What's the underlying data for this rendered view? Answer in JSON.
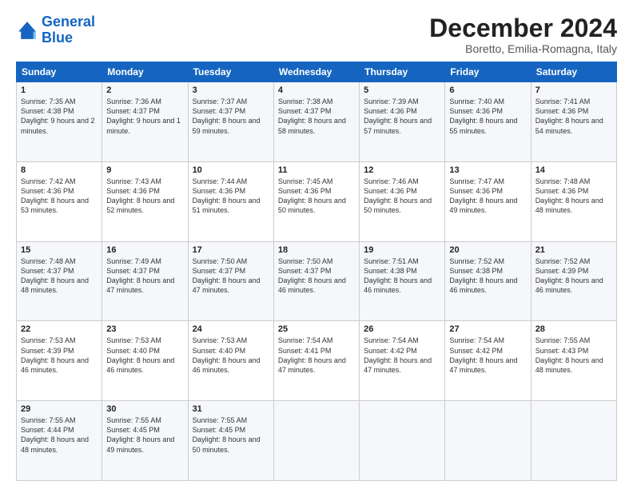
{
  "logo": {
    "line1": "General",
    "line2": "Blue"
  },
  "title": "December 2024",
  "location": "Boretto, Emilia-Romagna, Italy",
  "days_of_week": [
    "Sunday",
    "Monday",
    "Tuesday",
    "Wednesday",
    "Thursday",
    "Friday",
    "Saturday"
  ],
  "weeks": [
    [
      {
        "day": 1,
        "sunrise": "7:35 AM",
        "sunset": "4:38 PM",
        "daylight": "9 hours and 2 minutes."
      },
      {
        "day": 2,
        "sunrise": "7:36 AM",
        "sunset": "4:37 PM",
        "daylight": "9 hours and 1 minute."
      },
      {
        "day": 3,
        "sunrise": "7:37 AM",
        "sunset": "4:37 PM",
        "daylight": "8 hours and 59 minutes."
      },
      {
        "day": 4,
        "sunrise": "7:38 AM",
        "sunset": "4:37 PM",
        "daylight": "8 hours and 58 minutes."
      },
      {
        "day": 5,
        "sunrise": "7:39 AM",
        "sunset": "4:36 PM",
        "daylight": "8 hours and 57 minutes."
      },
      {
        "day": 6,
        "sunrise": "7:40 AM",
        "sunset": "4:36 PM",
        "daylight": "8 hours and 55 minutes."
      },
      {
        "day": 7,
        "sunrise": "7:41 AM",
        "sunset": "4:36 PM",
        "daylight": "8 hours and 54 minutes."
      }
    ],
    [
      {
        "day": 8,
        "sunrise": "7:42 AM",
        "sunset": "4:36 PM",
        "daylight": "8 hours and 53 minutes."
      },
      {
        "day": 9,
        "sunrise": "7:43 AM",
        "sunset": "4:36 PM",
        "daylight": "8 hours and 52 minutes."
      },
      {
        "day": 10,
        "sunrise": "7:44 AM",
        "sunset": "4:36 PM",
        "daylight": "8 hours and 51 minutes."
      },
      {
        "day": 11,
        "sunrise": "7:45 AM",
        "sunset": "4:36 PM",
        "daylight": "8 hours and 50 minutes."
      },
      {
        "day": 12,
        "sunrise": "7:46 AM",
        "sunset": "4:36 PM",
        "daylight": "8 hours and 50 minutes."
      },
      {
        "day": 13,
        "sunrise": "7:47 AM",
        "sunset": "4:36 PM",
        "daylight": "8 hours and 49 minutes."
      },
      {
        "day": 14,
        "sunrise": "7:48 AM",
        "sunset": "4:36 PM",
        "daylight": "8 hours and 48 minutes."
      }
    ],
    [
      {
        "day": 15,
        "sunrise": "7:48 AM",
        "sunset": "4:37 PM",
        "daylight": "8 hours and 48 minutes."
      },
      {
        "day": 16,
        "sunrise": "7:49 AM",
        "sunset": "4:37 PM",
        "daylight": "8 hours and 47 minutes."
      },
      {
        "day": 17,
        "sunrise": "7:50 AM",
        "sunset": "4:37 PM",
        "daylight": "8 hours and 47 minutes."
      },
      {
        "day": 18,
        "sunrise": "7:50 AM",
        "sunset": "4:37 PM",
        "daylight": "8 hours and 46 minutes."
      },
      {
        "day": 19,
        "sunrise": "7:51 AM",
        "sunset": "4:38 PM",
        "daylight": "8 hours and 46 minutes."
      },
      {
        "day": 20,
        "sunrise": "7:52 AM",
        "sunset": "4:38 PM",
        "daylight": "8 hours and 46 minutes."
      },
      {
        "day": 21,
        "sunrise": "7:52 AM",
        "sunset": "4:39 PM",
        "daylight": "8 hours and 46 minutes."
      }
    ],
    [
      {
        "day": 22,
        "sunrise": "7:53 AM",
        "sunset": "4:39 PM",
        "daylight": "8 hours and 46 minutes."
      },
      {
        "day": 23,
        "sunrise": "7:53 AM",
        "sunset": "4:40 PM",
        "daylight": "8 hours and 46 minutes."
      },
      {
        "day": 24,
        "sunrise": "7:53 AM",
        "sunset": "4:40 PM",
        "daylight": "8 hours and 46 minutes."
      },
      {
        "day": 25,
        "sunrise": "7:54 AM",
        "sunset": "4:41 PM",
        "daylight": "8 hours and 47 minutes."
      },
      {
        "day": 26,
        "sunrise": "7:54 AM",
        "sunset": "4:42 PM",
        "daylight": "8 hours and 47 minutes."
      },
      {
        "day": 27,
        "sunrise": "7:54 AM",
        "sunset": "4:42 PM",
        "daylight": "8 hours and 47 minutes."
      },
      {
        "day": 28,
        "sunrise": "7:55 AM",
        "sunset": "4:43 PM",
        "daylight": "8 hours and 48 minutes."
      }
    ],
    [
      {
        "day": 29,
        "sunrise": "7:55 AM",
        "sunset": "4:44 PM",
        "daylight": "8 hours and 48 minutes."
      },
      {
        "day": 30,
        "sunrise": "7:55 AM",
        "sunset": "4:45 PM",
        "daylight": "8 hours and 49 minutes."
      },
      {
        "day": 31,
        "sunrise": "7:55 AM",
        "sunset": "4:45 PM",
        "daylight": "8 hours and 50 minutes."
      },
      null,
      null,
      null,
      null
    ]
  ]
}
